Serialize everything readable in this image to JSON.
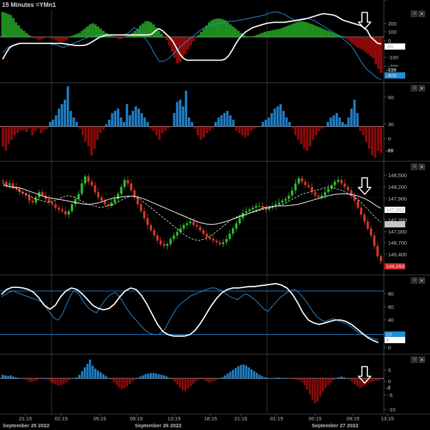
{
  "title": "15 Minutes =YMn1",
  "colors": {
    "up_green": "#1f8f1f",
    "down_red": "#8b0a0a",
    "hist_blue": "#1e7fc8",
    "candle_green": "#2fbf2f",
    "candle_red": "#d23a2a",
    "white": "#ffffff",
    "badge_blue": "#1e8fd8",
    "badge_red": "#d62020",
    "grid": "#3a3a3a",
    "level_line": "#2a8ad6"
  },
  "icons": [
    "down-arrow-icon",
    "expand-icon",
    "close-icon"
  ],
  "time_axis": {
    "ticks": [
      "21:15",
      "01:15",
      "05:15",
      "09:15",
      "13:15",
      "18:15",
      "21:15",
      "01:15",
      "05:15",
      "09:15",
      "13:15"
    ],
    "dates": [
      "September 25 2022",
      "September 26 2022",
      "September 27 2022"
    ]
  },
  "chart_data": [
    {
      "type": "bar",
      "panel": "oscillator-1",
      "ylim": [
        -420,
        260
      ],
      "ticks": [
        "200",
        "100",
        "0",
        "-100",
        "-200"
      ],
      "badges": [
        "-65",
        "-338",
        "-405"
      ],
      "histogram": [
        240,
        230,
        220,
        210,
        180,
        140,
        110,
        80,
        60,
        40,
        20,
        0,
        -10,
        -20,
        -30,
        -20,
        -10,
        -5,
        -10,
        -20,
        -30,
        -40,
        -50,
        -40,
        -30,
        -10,
        10,
        20,
        30,
        40,
        60,
        80,
        100,
        120,
        130,
        120,
        100,
        80,
        60,
        40,
        20,
        10,
        0,
        -10,
        -20,
        -15,
        -5,
        10,
        20,
        40,
        60,
        80,
        110,
        130,
        150,
        150,
        140,
        120,
        90,
        60,
        30,
        0,
        -30,
        -80,
        -140,
        -200,
        -250,
        -240,
        -200,
        -160,
        -120,
        -80,
        -40,
        -10,
        20,
        50,
        80,
        110,
        140,
        160,
        170,
        175,
        175,
        170,
        160,
        140,
        120,
        100,
        80,
        60,
        40,
        20,
        10,
        0,
        5,
        10,
        20,
        30,
        40,
        50,
        55,
        60,
        65,
        70,
        75,
        80,
        90,
        100,
        110,
        120,
        130,
        140,
        150,
        150,
        145,
        140,
        130,
        120,
        110,
        100,
        90,
        80,
        70,
        60,
        50,
        40,
        30,
        20,
        10,
        0,
        -20,
        -40,
        -60,
        -80,
        -100,
        -110,
        -120,
        -140,
        -160,
        -180,
        -200,
        -260,
        -300,
        -340
      ],
      "signal_line": [
        -210,
        -150,
        -100,
        -80,
        -70,
        -60,
        -60,
        -60,
        -60,
        -60,
        -60,
        -60,
        -60,
        -60,
        -60,
        -60,
        -60,
        -60,
        -65,
        -70,
        -75,
        -80,
        -80,
        -80,
        -75,
        -60,
        -40,
        -20,
        0,
        10,
        20,
        20,
        20,
        20,
        20,
        20,
        20,
        20,
        20,
        20,
        20,
        20,
        20,
        30,
        60,
        80,
        60,
        30,
        0,
        -40,
        -100,
        -160,
        -200,
        -220,
        -220,
        -220,
        -220,
        -220,
        -220,
        -220,
        -220,
        -220,
        -220,
        -220,
        -210,
        -180,
        -130,
        -70,
        -20,
        20,
        50,
        70,
        90,
        100,
        110,
        120,
        130,
        135,
        140,
        140,
        140,
        140,
        145,
        150,
        155,
        160,
        165,
        170,
        180,
        190,
        200,
        210,
        220,
        220,
        215,
        210,
        200,
        180,
        160,
        150,
        140,
        130,
        120,
        110,
        90,
        60,
        0,
        -30,
        -60,
        -65
      ],
      "fast_line": [
        -150,
        -100,
        -80,
        -60,
        -60,
        -60,
        -60,
        -60,
        -60,
        -60,
        -70,
        -80,
        -100,
        -80,
        -60,
        -40,
        -20,
        0,
        10,
        20,
        20,
        20,
        20,
        20,
        20,
        40,
        90,
        60,
        0,
        -60,
        -150,
        -230,
        -230,
        -200,
        -150,
        -100,
        -60,
        -20,
        20,
        60,
        90,
        110,
        120,
        130,
        140,
        150,
        150,
        160,
        170,
        180,
        190,
        200,
        210,
        230,
        240,
        230,
        210,
        180,
        160,
        170,
        180,
        170,
        150,
        120,
        90,
        60,
        30,
        0,
        -40,
        -80,
        -150,
        -230,
        -300,
        -338,
        -380,
        -405
      ]
    },
    {
      "type": "bar",
      "panel": "oscillator-2",
      "ylim": [
        -75,
        95
      ],
      "ticks": [
        "60",
        "30",
        "0",
        "-30"
      ],
      "badges": [
        "-59"
      ],
      "values": [
        -45,
        -55,
        -40,
        -30,
        -20,
        -15,
        -10,
        -8,
        -12,
        -5,
        -20,
        -10,
        -5,
        -15,
        -8,
        -5,
        10,
        15,
        25,
        40,
        50,
        60,
        90,
        35,
        20,
        10,
        -5,
        -20,
        -35,
        -45,
        -65,
        -50,
        -30,
        -15,
        -8,
        5,
        15,
        30,
        35,
        40,
        20,
        10,
        50,
        25,
        35,
        45,
        40,
        30,
        20,
        10,
        -5,
        -10,
        -20,
        -30,
        -15,
        -10,
        -5,
        -2,
        30,
        55,
        60,
        45,
        80,
        20,
        10,
        -5,
        -20,
        -30,
        -25,
        -15,
        -10,
        -5,
        10,
        20,
        25,
        30,
        35,
        25,
        15,
        -10,
        -15,
        -20,
        -25,
        -20,
        -10,
        -5,
        -2,
        0,
        10,
        15,
        20,
        30,
        40,
        45,
        50,
        35,
        20,
        10,
        -5,
        -20,
        -30,
        -40,
        -50,
        -55,
        -45,
        -30,
        -20,
        -10,
        -5,
        -2,
        10,
        20,
        25,
        30,
        20,
        10,
        5,
        20,
        40,
        60,
        30,
        -10,
        -20,
        -35,
        -50,
        -65,
        -70,
        -55,
        -59
      ]
    },
    {
      "type": "candlestick",
      "panel": "price",
      "ylim": [
        145700,
        148900
      ],
      "ticks": [
        "148,500",
        "148,200",
        "147,900",
        "147,300",
        "147,000",
        "146,700",
        "146,400"
      ],
      "badges": [
        "147,582",
        "147,179",
        "146,055"
      ],
      "close": [
        148350,
        148250,
        148300,
        148200,
        148150,
        148050,
        148000,
        147950,
        147800,
        147750,
        147900,
        148050,
        147950,
        147850,
        147750,
        147700,
        147600,
        147550,
        147500,
        147400,
        147500,
        147700,
        147850,
        148000,
        148300,
        148500,
        148350,
        148250,
        148050,
        147900,
        147800,
        147700,
        147650,
        147750,
        147850,
        148000,
        148200,
        148400,
        148300,
        148100,
        147900,
        147700,
        147500,
        147300,
        147100,
        146950,
        146800,
        146650,
        146550,
        146500,
        146550,
        146700,
        146800,
        146900,
        147000,
        147100,
        147150,
        147200,
        147100,
        147050,
        146950,
        146850,
        146750,
        146700,
        146650,
        146600,
        146550,
        146600,
        146700,
        146850,
        147000,
        147150,
        147300,
        147450,
        147500,
        147550,
        147600,
        147650,
        147650,
        147600,
        147550,
        147600,
        147650,
        147700,
        147750,
        147800,
        147850,
        147950,
        148100,
        148300,
        148450,
        148350,
        148250,
        148200,
        148050,
        147950,
        147900,
        147950,
        148050,
        148150,
        148250,
        148350,
        148400,
        148300,
        148200,
        148100,
        147950,
        147800,
        147600,
        147400,
        147200,
        147000,
        146800,
        146500,
        146200,
        146055
      ],
      "ma_solid": [
        148250,
        148220,
        148200,
        148180,
        148150,
        148100,
        148050,
        148000,
        147950,
        147900,
        147870,
        147850,
        147830,
        147800,
        147780,
        147750,
        147720,
        147700,
        147700,
        147720,
        147750,
        147800,
        147850,
        147880,
        147900,
        147920,
        147930,
        147930,
        147900,
        147860,
        147800,
        147740,
        147680,
        147620,
        147560,
        147500,
        147440,
        147380,
        147320,
        147260,
        147200,
        147160,
        147130,
        147120,
        147130,
        147160,
        147200,
        147250,
        147300,
        147350,
        147400,
        147450,
        147500,
        147550,
        147600,
        147620,
        147640,
        147650,
        147650,
        147660,
        147680,
        147700,
        147740,
        147780,
        147820,
        147860,
        147900,
        147940,
        147970,
        147990,
        148000,
        148000,
        147980,
        147950,
        147900,
        147840,
        147760,
        147660,
        147582
      ],
      "ma_dashed": [
        148300,
        148200,
        148150,
        148050,
        147950,
        147850,
        147800,
        147750,
        147800,
        147900,
        147950,
        147900,
        147800,
        147700,
        147650,
        147600,
        147650,
        147700,
        147800,
        147900,
        147950,
        147850,
        147700,
        147550,
        147400,
        147250,
        147100,
        146950,
        146800,
        146700,
        146650,
        146700,
        146800,
        146950,
        147100,
        147250,
        147350,
        147400,
        147450,
        147500,
        147550,
        147600,
        147650,
        147700,
        147800,
        147900,
        148000,
        148050,
        148100,
        148150,
        148200,
        148150,
        148100,
        148000,
        147900,
        147750,
        147550,
        147350,
        147179
      ]
    },
    {
      "type": "line",
      "panel": "stochastic",
      "ylim": [
        -5,
        100
      ],
      "ticks": [
        "80",
        "60",
        "40",
        "20",
        "0"
      ],
      "levels": [
        80,
        20
      ],
      "badges": [
        "13",
        "9"
      ],
      "fast_line": [
        72,
        75,
        78,
        80,
        78,
        76,
        74,
        72,
        70,
        68,
        66,
        64,
        55,
        48,
        42,
        40,
        48,
        60,
        72,
        80,
        78,
        70,
        62,
        56,
        52,
        50,
        58,
        66,
        72,
        76,
        78,
        72,
        64,
        55,
        48,
        42,
        36,
        30,
        25,
        22,
        20,
        20,
        22,
        28,
        38,
        48,
        56,
        62,
        66,
        70,
        74,
        76,
        78,
        80,
        82,
        84,
        84,
        82,
        80,
        76,
        72,
        70,
        68,
        72,
        76,
        74,
        70,
        66,
        60,
        55,
        52,
        58,
        64,
        70,
        74,
        78,
        80,
        82,
        78,
        72,
        66,
        58,
        50,
        44,
        40,
        38,
        40,
        42,
        40,
        38,
        36,
        34,
        30,
        26,
        22,
        20,
        18,
        16,
        14,
        13
      ],
      "slow_line": [
        75,
        82,
        85,
        85,
        84,
        82,
        78,
        70,
        60,
        55,
        60,
        72,
        80,
        84,
        82,
        76,
        68,
        60,
        56,
        54,
        56,
        62,
        72,
        80,
        84,
        82,
        74,
        62,
        48,
        34,
        24,
        20,
        18,
        18,
        18,
        20,
        26,
        36,
        48,
        60,
        70,
        78,
        82,
        84,
        84,
        85,
        86,
        86,
        87,
        88,
        89,
        90,
        88,
        84,
        76,
        64,
        50,
        40,
        36,
        34,
        36,
        38,
        40,
        40,
        38,
        34,
        28,
        22,
        16,
        12,
        9
      ]
    },
    {
      "type": "bar",
      "panel": "oscillator-3",
      "ylim": [
        -11.5,
        7.5
      ],
      "ticks": [
        "5",
        "0",
        "-5",
        "-10"
      ],
      "badges": [
        "-2"
      ],
      "values": [
        1.2,
        1.0,
        0.8,
        1.0,
        0.6,
        0.4,
        0.2,
        0.1,
        0,
        -0.5,
        -1.0,
        -1.2,
        -0.8,
        -0.6,
        -0.2,
        0.2,
        0,
        -0.4,
        -1.0,
        -1.6,
        -2.0,
        -2.4,
        -2.2,
        -1.8,
        -1.2,
        -0.6,
        -0.2,
        0,
        0.4,
        1.2,
        2.4,
        3.6,
        4.8,
        6.2,
        4.2,
        3.2,
        2.6,
        2.0,
        1.4,
        0.8,
        0.2,
        -0.4,
        -1.2,
        -2.2,
        -3.0,
        -3.6,
        -3.2,
        -2.6,
        -1.8,
        -1.0,
        -0.4,
        0.2,
        0.6,
        1.0,
        1.4,
        1.6,
        1.8,
        1.8,
        1.6,
        1.4,
        1.2,
        1.0,
        0.6,
        0.2,
        -0.4,
        -1.2,
        -2.0,
        -3.0,
        -3.8,
        -4.2,
        -3.4,
        -2.6,
        -1.8,
        -1.0,
        -0.4,
        0,
        -0.4,
        -1.0,
        -1.4,
        -1.2,
        -0.8,
        -0.4,
        0,
        0.4,
        1.0,
        1.6,
        2.2,
        2.8,
        3.4,
        4.0,
        4.4,
        4.6,
        4.2,
        3.6,
        3.0,
        2.4,
        1.8,
        1.2,
        0.8,
        0.4,
        0.2,
        0,
        0.1,
        0.2,
        0.3,
        0.2,
        0.1,
        0,
        -0.1,
        -0.2,
        -0.3,
        -0.4,
        -0.6,
        -1.2,
        -2.2,
        -3.6,
        -5.2,
        -7.0,
        -8.2,
        -7.6,
        -6.0,
        -4.4,
        -3.2,
        -2.2,
        -1.4,
        -0.6,
        0,
        0.4,
        0.6,
        0.4,
        0,
        -0.4,
        -1.0,
        -1.8,
        -2.6,
        -3.2,
        -2.8,
        -2.2,
        -1.6,
        -1.2,
        -1.0,
        -0.8,
        -0.6,
        -0.4
      ]
    }
  ]
}
